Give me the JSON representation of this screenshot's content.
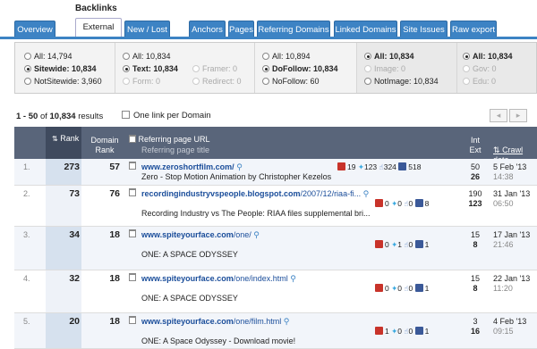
{
  "tabs": {
    "group_label": "Backlinks",
    "items": [
      {
        "label": "Overview"
      },
      {
        "label": "External"
      },
      {
        "label": "New / Lost"
      },
      {
        "label": "Anchors"
      },
      {
        "label": "Pages"
      },
      {
        "label": "Referring Domains"
      },
      {
        "label": "Linked Domains"
      },
      {
        "label": "Site Issues"
      },
      {
        "label": "Raw export"
      }
    ]
  },
  "filters": {
    "col1": [
      {
        "label": "All:",
        "value": "14,794"
      },
      {
        "label": "Sitewide:",
        "value": "10,834"
      },
      {
        "label": "NotSitewide:",
        "value": "3,960"
      }
    ],
    "col2": [
      {
        "label": "All:",
        "value": "10,834"
      },
      {
        "label": "Text:",
        "value": "10,834"
      },
      {
        "label": "Framer:",
        "value": "0"
      },
      {
        "label": "Form:",
        "value": "0"
      },
      {
        "label": "Redirect:",
        "value": "0"
      }
    ],
    "col3": [
      {
        "label": "All:",
        "value": "10,894"
      },
      {
        "label": "DoFollow:",
        "value": "10,834"
      },
      {
        "label": "NoFollow:",
        "value": "60"
      }
    ],
    "col4": [
      {
        "label": "All:",
        "value": "10,834"
      },
      {
        "label": "Image:",
        "value": "0"
      },
      {
        "label": "NotImage:",
        "value": "10,834"
      }
    ],
    "col5": [
      {
        "label": "All:",
        "value": "10,834"
      },
      {
        "label": "Gov:",
        "value": "0"
      },
      {
        "label": "Edu:",
        "value": "0"
      }
    ]
  },
  "results": {
    "range": "1 - 50",
    "of": "of",
    "total": "10,834",
    "suffix": "results",
    "one_link_label": "One link per Domain",
    "prev": "◂",
    "next": "▸"
  },
  "table": {
    "headers": {
      "rank": "Rank",
      "domain_rank_1": "Domain",
      "domain_rank_2": "Rank",
      "url": "Referring page URL",
      "title": "Referring page title",
      "int": "Int",
      "ext": "Ext",
      "crawl": "Crawl date"
    },
    "rows": [
      {
        "n": "1.",
        "rank": "273",
        "domain_rank": "57",
        "url_main": "www.zeroshortfilm.com/",
        "url_rest": "",
        "title": "Zero - Stop Motion Animation by Christopher Kezelos",
        "gp": "19",
        "tw": "123",
        "like": "324",
        "fb": "518",
        "int": "50",
        "ext": "26",
        "date": "5 Feb '13",
        "time": "14:38"
      },
      {
        "n": "2.",
        "rank": "73",
        "domain_rank": "76",
        "url_main": "recordingindustryvspeople.blogspot.com",
        "url_rest": "/2007/12/riaa-fi...",
        "title": "Recording Industry vs The People: RIAA files supplemental bri...",
        "gp": "0",
        "tw": "0",
        "like": "0",
        "fb": "8",
        "int": "190",
        "ext": "123",
        "date": "31 Jan '13",
        "time": "06:50"
      },
      {
        "n": "3.",
        "rank": "34",
        "domain_rank": "18",
        "url_main": "www.spiteyourface.com",
        "url_rest": "/one/",
        "title": "ONE: A SPACE ODYSSEY",
        "gp": "0",
        "tw": "1",
        "like": "0",
        "fb": "1",
        "int": "15",
        "ext": "8",
        "date": "17 Jan '13",
        "time": "21:46"
      },
      {
        "n": "4.",
        "rank": "32",
        "domain_rank": "18",
        "url_main": "www.spiteyourface.com",
        "url_rest": "/one/index.html",
        "title": "ONE: A SPACE ODYSSEY",
        "gp": "0",
        "tw": "0",
        "like": "0",
        "fb": "1",
        "int": "15",
        "ext": "8",
        "date": "22 Jan '13",
        "time": "11:20"
      },
      {
        "n": "5.",
        "rank": "20",
        "domain_rank": "18",
        "url_main": "www.spiteyourface.com",
        "url_rest": "/one/film.html",
        "title": "ONE: A Space Odyssey - Download movie!",
        "gp": "1",
        "tw": "0",
        "like": "0",
        "fb": "1",
        "int": "3",
        "ext": "16",
        "date": "4 Feb '13",
        "time": "09:15"
      }
    ]
  }
}
